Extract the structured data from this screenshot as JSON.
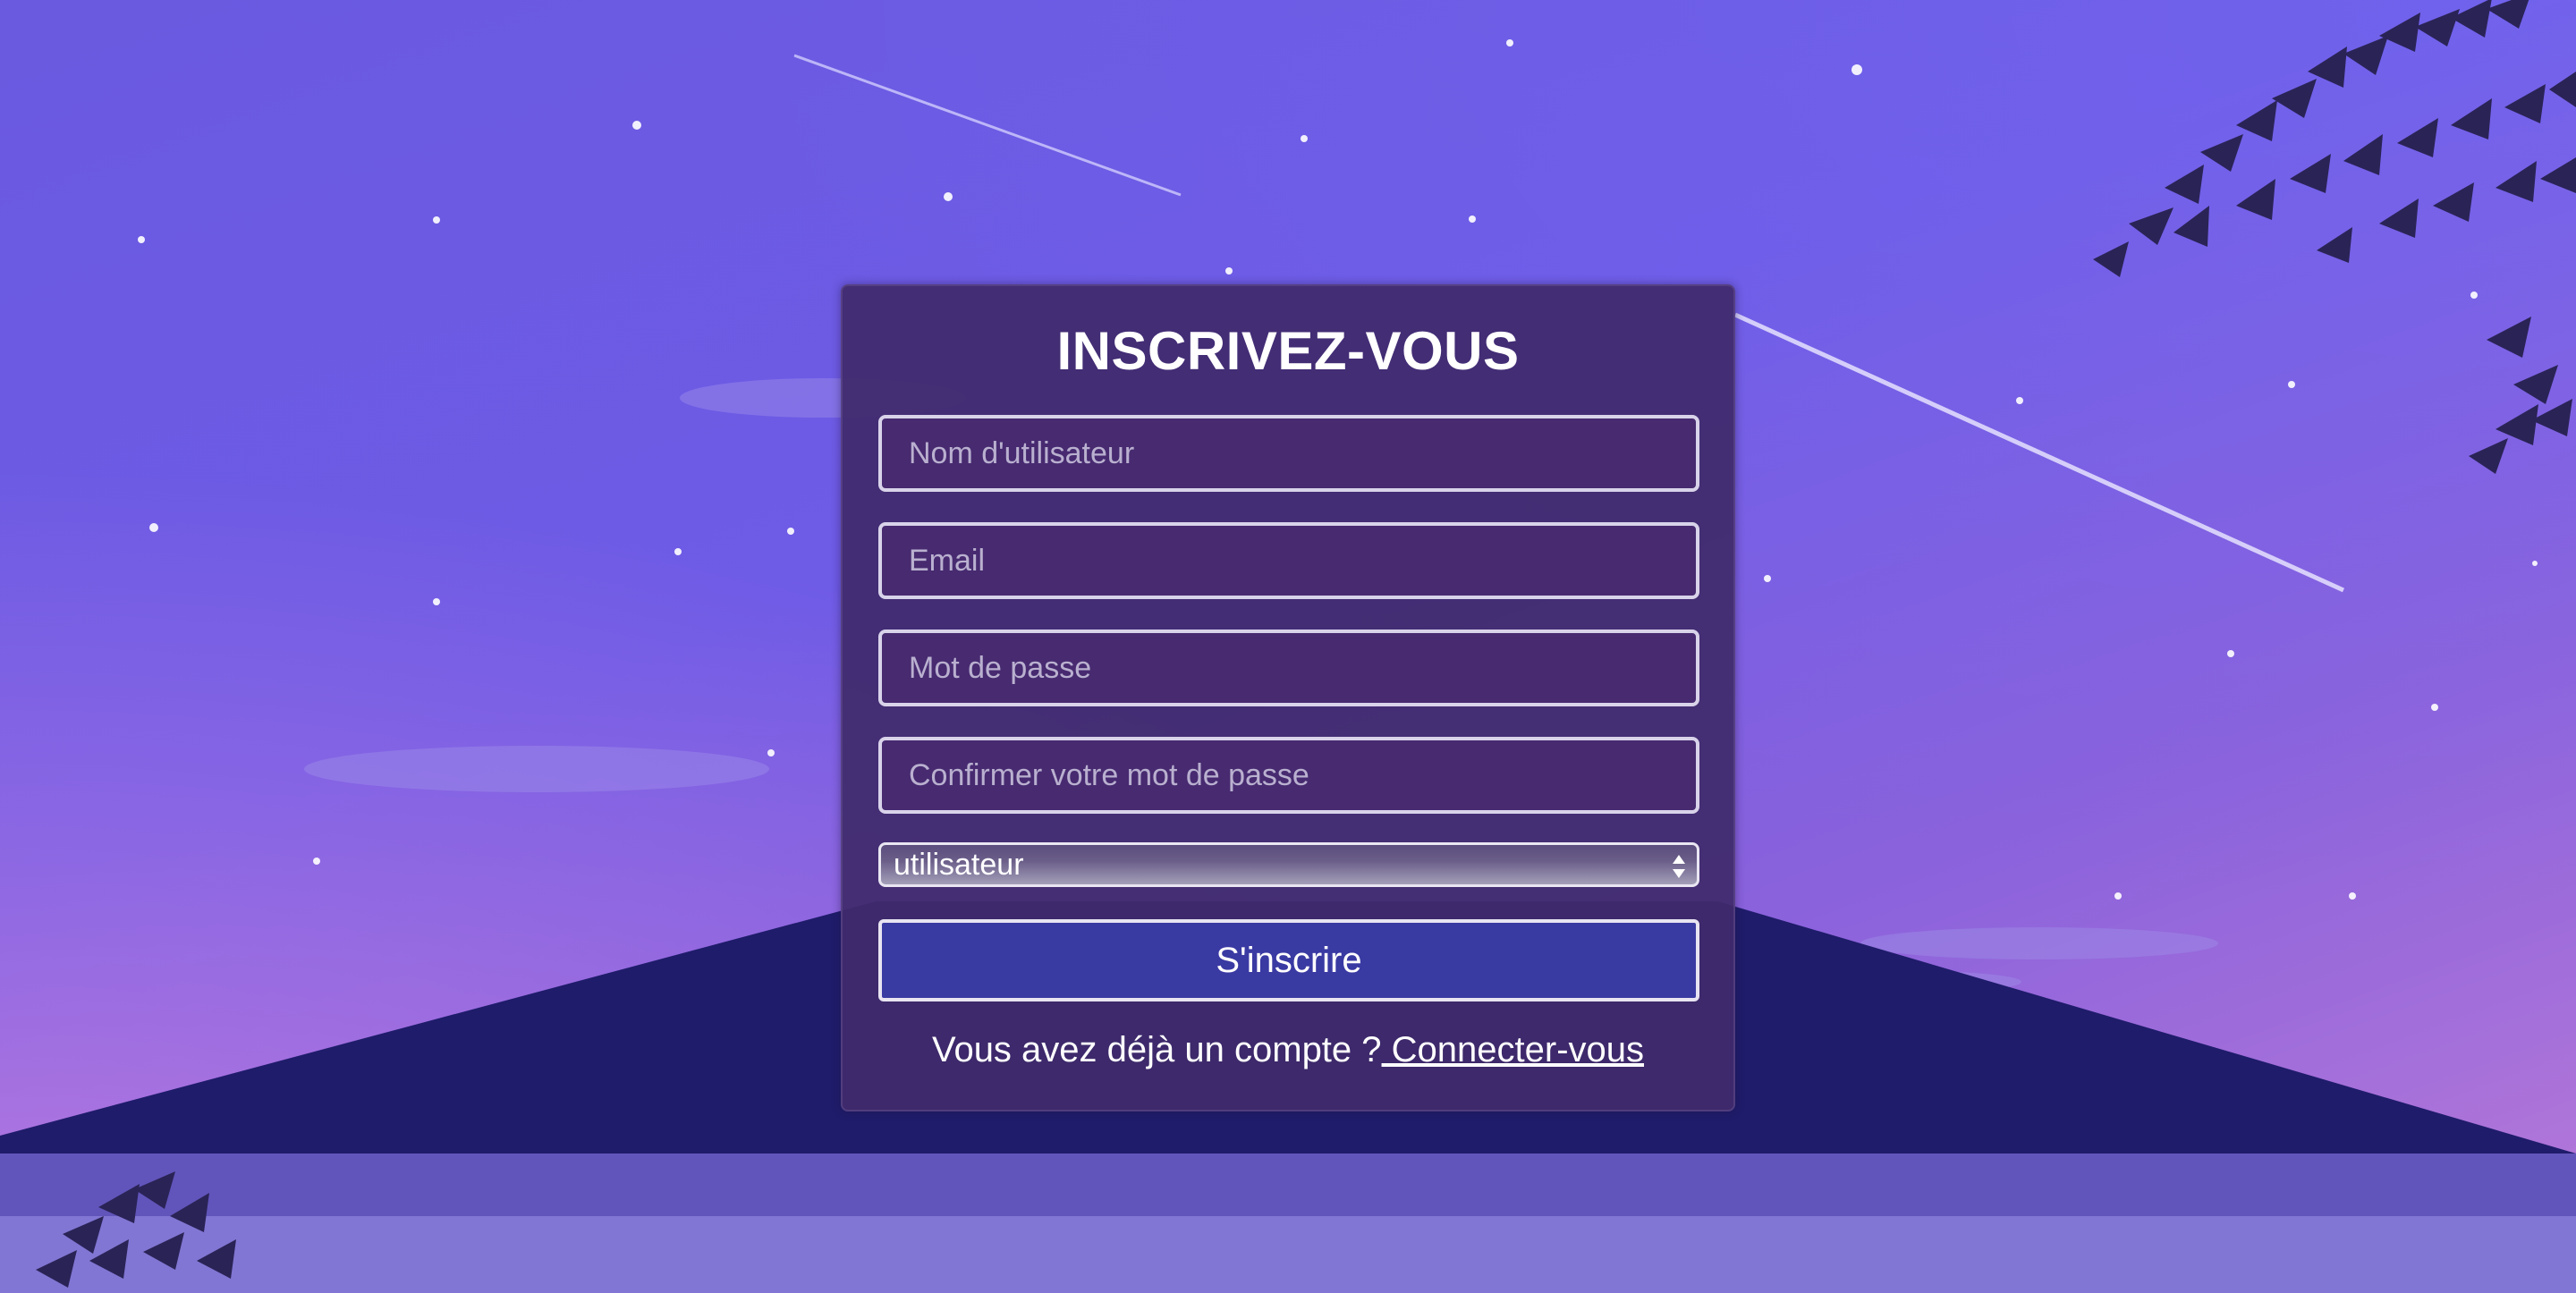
{
  "form": {
    "title": "INSCRIVEZ-VOUS",
    "username_placeholder": "Nom d'utilisateur",
    "email_placeholder": "Email",
    "password_placeholder": "Mot de passe",
    "confirm_placeholder": "Confirmer votre mot de passe",
    "role_selected": "utilisateur",
    "submit_label": "S'inscrire",
    "footer_text": "Vous avez déjà un compte ?",
    "footer_link": " Connecter-vous"
  },
  "colors": {
    "background": "#6e5be6",
    "card": "#402a6c",
    "button": "#3a3aa3",
    "text": "#ffffff"
  },
  "icons": {
    "select": "chevron-up-down-icon"
  }
}
